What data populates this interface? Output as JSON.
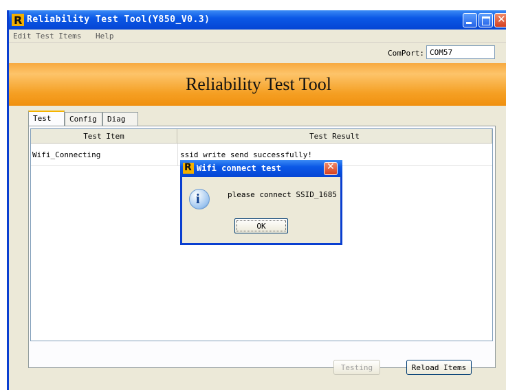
{
  "window": {
    "title": "Reliability Test Tool(Y850_V0.3)",
    "logo_letter": "R"
  },
  "menu": [
    "Edit Test Items",
    "Help"
  ],
  "comport": {
    "label": "ComPort:",
    "value": "COM57"
  },
  "banner": {
    "title": "Reliability Test Tool"
  },
  "tabs": [
    {
      "label": "Test",
      "selected": true
    },
    {
      "label": "Config",
      "selected": false
    },
    {
      "label": "Diag",
      "selected": false
    }
  ],
  "table": {
    "columns": [
      "Test Item",
      "Test Result"
    ],
    "rows": [
      {
        "item": "Wifi_Connecting",
        "result": "ssid write send successfully!"
      }
    ]
  },
  "buttons": {
    "testing": "Testing",
    "reload": "Reload Items"
  },
  "dialog": {
    "title": "Wifi connect test",
    "message": "please connect SSID_1685",
    "ok": "OK",
    "icon": "info-icon"
  },
  "colors": {
    "titlebar": "#0b58e6",
    "banner": "#f5a024",
    "close": "#d44020"
  }
}
